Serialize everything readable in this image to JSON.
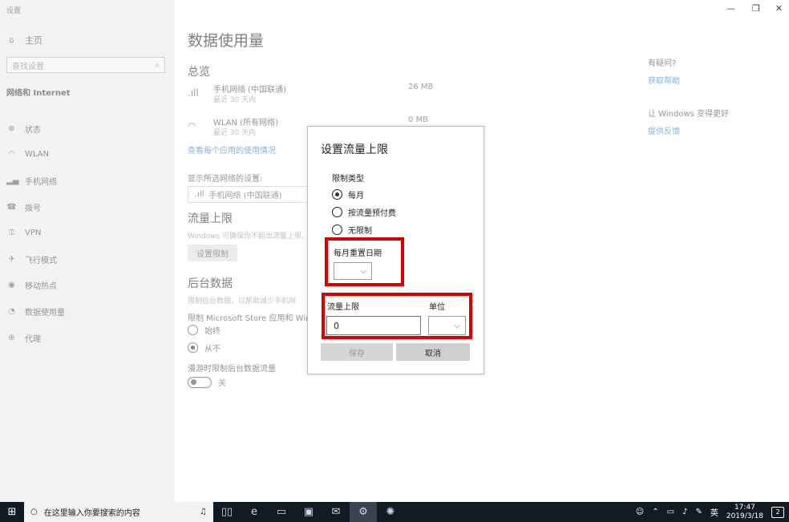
{
  "window": {
    "title": "设置",
    "controls": {
      "minimize": "—",
      "maximize": "❐",
      "close": "✕"
    }
  },
  "sidebar": {
    "home_label": "主页",
    "search_placeholder": "查找设置",
    "section_label": "网络和 Internet",
    "items": [
      {
        "icon": "globe-icon",
        "label": "状态"
      },
      {
        "icon": "wifi-icon",
        "label": "WLAN"
      },
      {
        "icon": "cellular-icon",
        "label": "手机网络"
      },
      {
        "icon": "dialup-icon",
        "label": "拨号"
      },
      {
        "icon": "vpn-icon",
        "label": "VPN"
      },
      {
        "icon": "airplane-icon",
        "label": "飞行模式"
      },
      {
        "icon": "hotspot-icon",
        "label": "移动热点"
      },
      {
        "icon": "data-usage-icon",
        "label": "数据使用量"
      },
      {
        "icon": "proxy-icon",
        "label": "代理"
      }
    ]
  },
  "main": {
    "title": "数据使用量",
    "overview_heading": "总览",
    "networks": [
      {
        "name": "手机网络 (中国联通)",
        "sub": "最近 30 天内",
        "size": "26 MB"
      },
      {
        "name": "WLAN (所有网络)",
        "sub": "最近 30 天内",
        "size": "0 MB"
      }
    ],
    "per_app_link": "查看每个应用的使用情况",
    "show_settings_label": "显示所选网络的设置:",
    "selected_network": "手机网络 (中国联通)",
    "limit_heading": "流量上限",
    "limit_desc": "Windows 可确保你不超出流量上限。",
    "set_limit_button": "设置限制",
    "bg_heading": "后台数据",
    "bg_desc": "限制后台数据，以帮助减少手机网",
    "bg_restrict_label": "限制 Microsoft Store 应用和 Windo",
    "bg_options": [
      "始终",
      "从不"
    ],
    "bg_selected": 1,
    "roaming_label": "漫游时限制后台数据流量",
    "roaming_toggle": "关"
  },
  "right": {
    "question": "有疑问?",
    "help_link": "获取帮助",
    "improve": "让 Windows 变得更好",
    "feedback_link": "提供反馈"
  },
  "dialog": {
    "title": "设置流量上限",
    "limit_type_label": "限制类型",
    "options": [
      "每月",
      "按流量预付费",
      "无限制"
    ],
    "selected_option": 0,
    "reset_date_label": "每月重置日期",
    "reset_date_value": "",
    "limit_label": "流量上限",
    "limit_value": "0",
    "unit_label": "单位",
    "unit_value": "",
    "save_button": "保存",
    "cancel_button": "取消",
    "highlight_color": "#d60000"
  },
  "taskbar": {
    "search_placeholder": "在这里输入你要搜索的内容",
    "apps": [
      "task-view-icon",
      "edge-icon",
      "file-explorer-icon",
      "store-icon",
      "mail-icon",
      "settings-icon",
      "app-icon"
    ],
    "active_app": "settings-icon",
    "ime": "英",
    "time": "17:47",
    "date": "2019/3/18",
    "notifications": "2"
  }
}
